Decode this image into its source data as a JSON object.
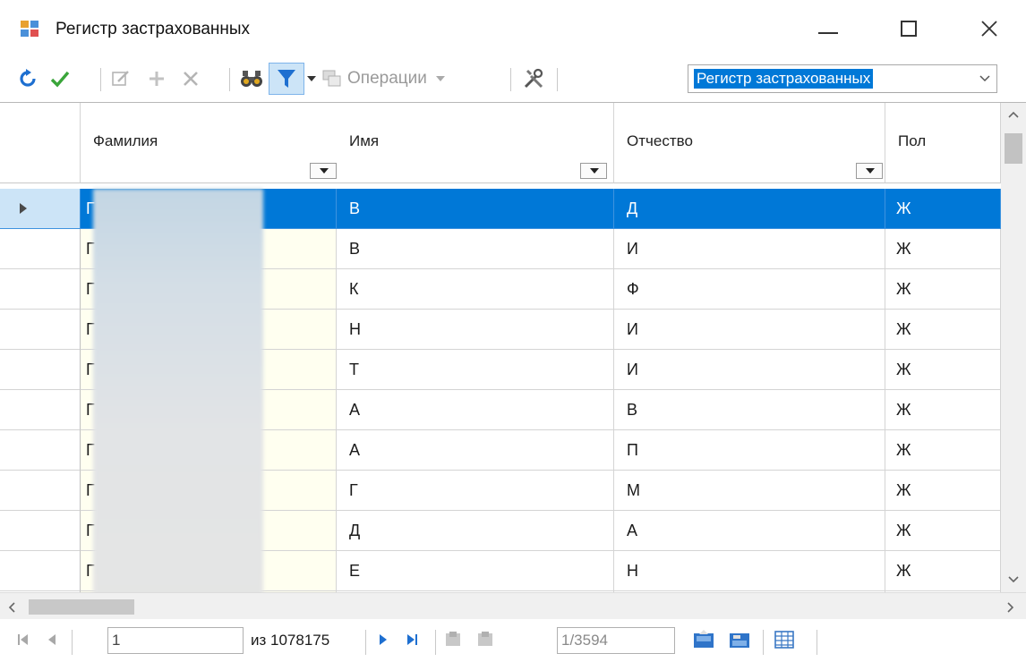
{
  "window": {
    "title": "Регистр застрахованных"
  },
  "toolbar": {
    "operations_label": "Операции",
    "register_combo_value": "Регистр застрахованных"
  },
  "grid": {
    "columns": [
      "Фамилия",
      "Имя",
      "Отчество",
      "Пол"
    ],
    "rows": [
      {
        "surname": "Г",
        "name": "В",
        "patronymic": "Д",
        "sex": "Ж",
        "selected": true
      },
      {
        "surname": "Г",
        "name": "В",
        "patronymic": "И",
        "sex": "Ж"
      },
      {
        "surname": "Г",
        "name": "К",
        "patronymic": "Ф",
        "sex": "Ж"
      },
      {
        "surname": "Г",
        "name": "Н",
        "patronymic": "И",
        "sex": "Ж"
      },
      {
        "surname": "Г",
        "name": "Т",
        "patronymic": "И",
        "sex": "Ж"
      },
      {
        "surname": "Г",
        "name": "А",
        "patronymic": "В",
        "sex": "Ж"
      },
      {
        "surname": "Г",
        "name": "А",
        "patronymic": "П",
        "sex": "Ж"
      },
      {
        "surname": "Г",
        "name": "Г",
        "patronymic": "М",
        "sex": "Ж"
      },
      {
        "surname": "Г",
        "name": "Д",
        "patronymic": "А",
        "sex": "Ж"
      },
      {
        "surname": "Г",
        "name": "Е",
        "patronymic": "Н",
        "sex": "Ж"
      }
    ]
  },
  "navigator": {
    "current_record": "1",
    "total_records_label": "из 1078175",
    "page_label": "1/3594"
  }
}
